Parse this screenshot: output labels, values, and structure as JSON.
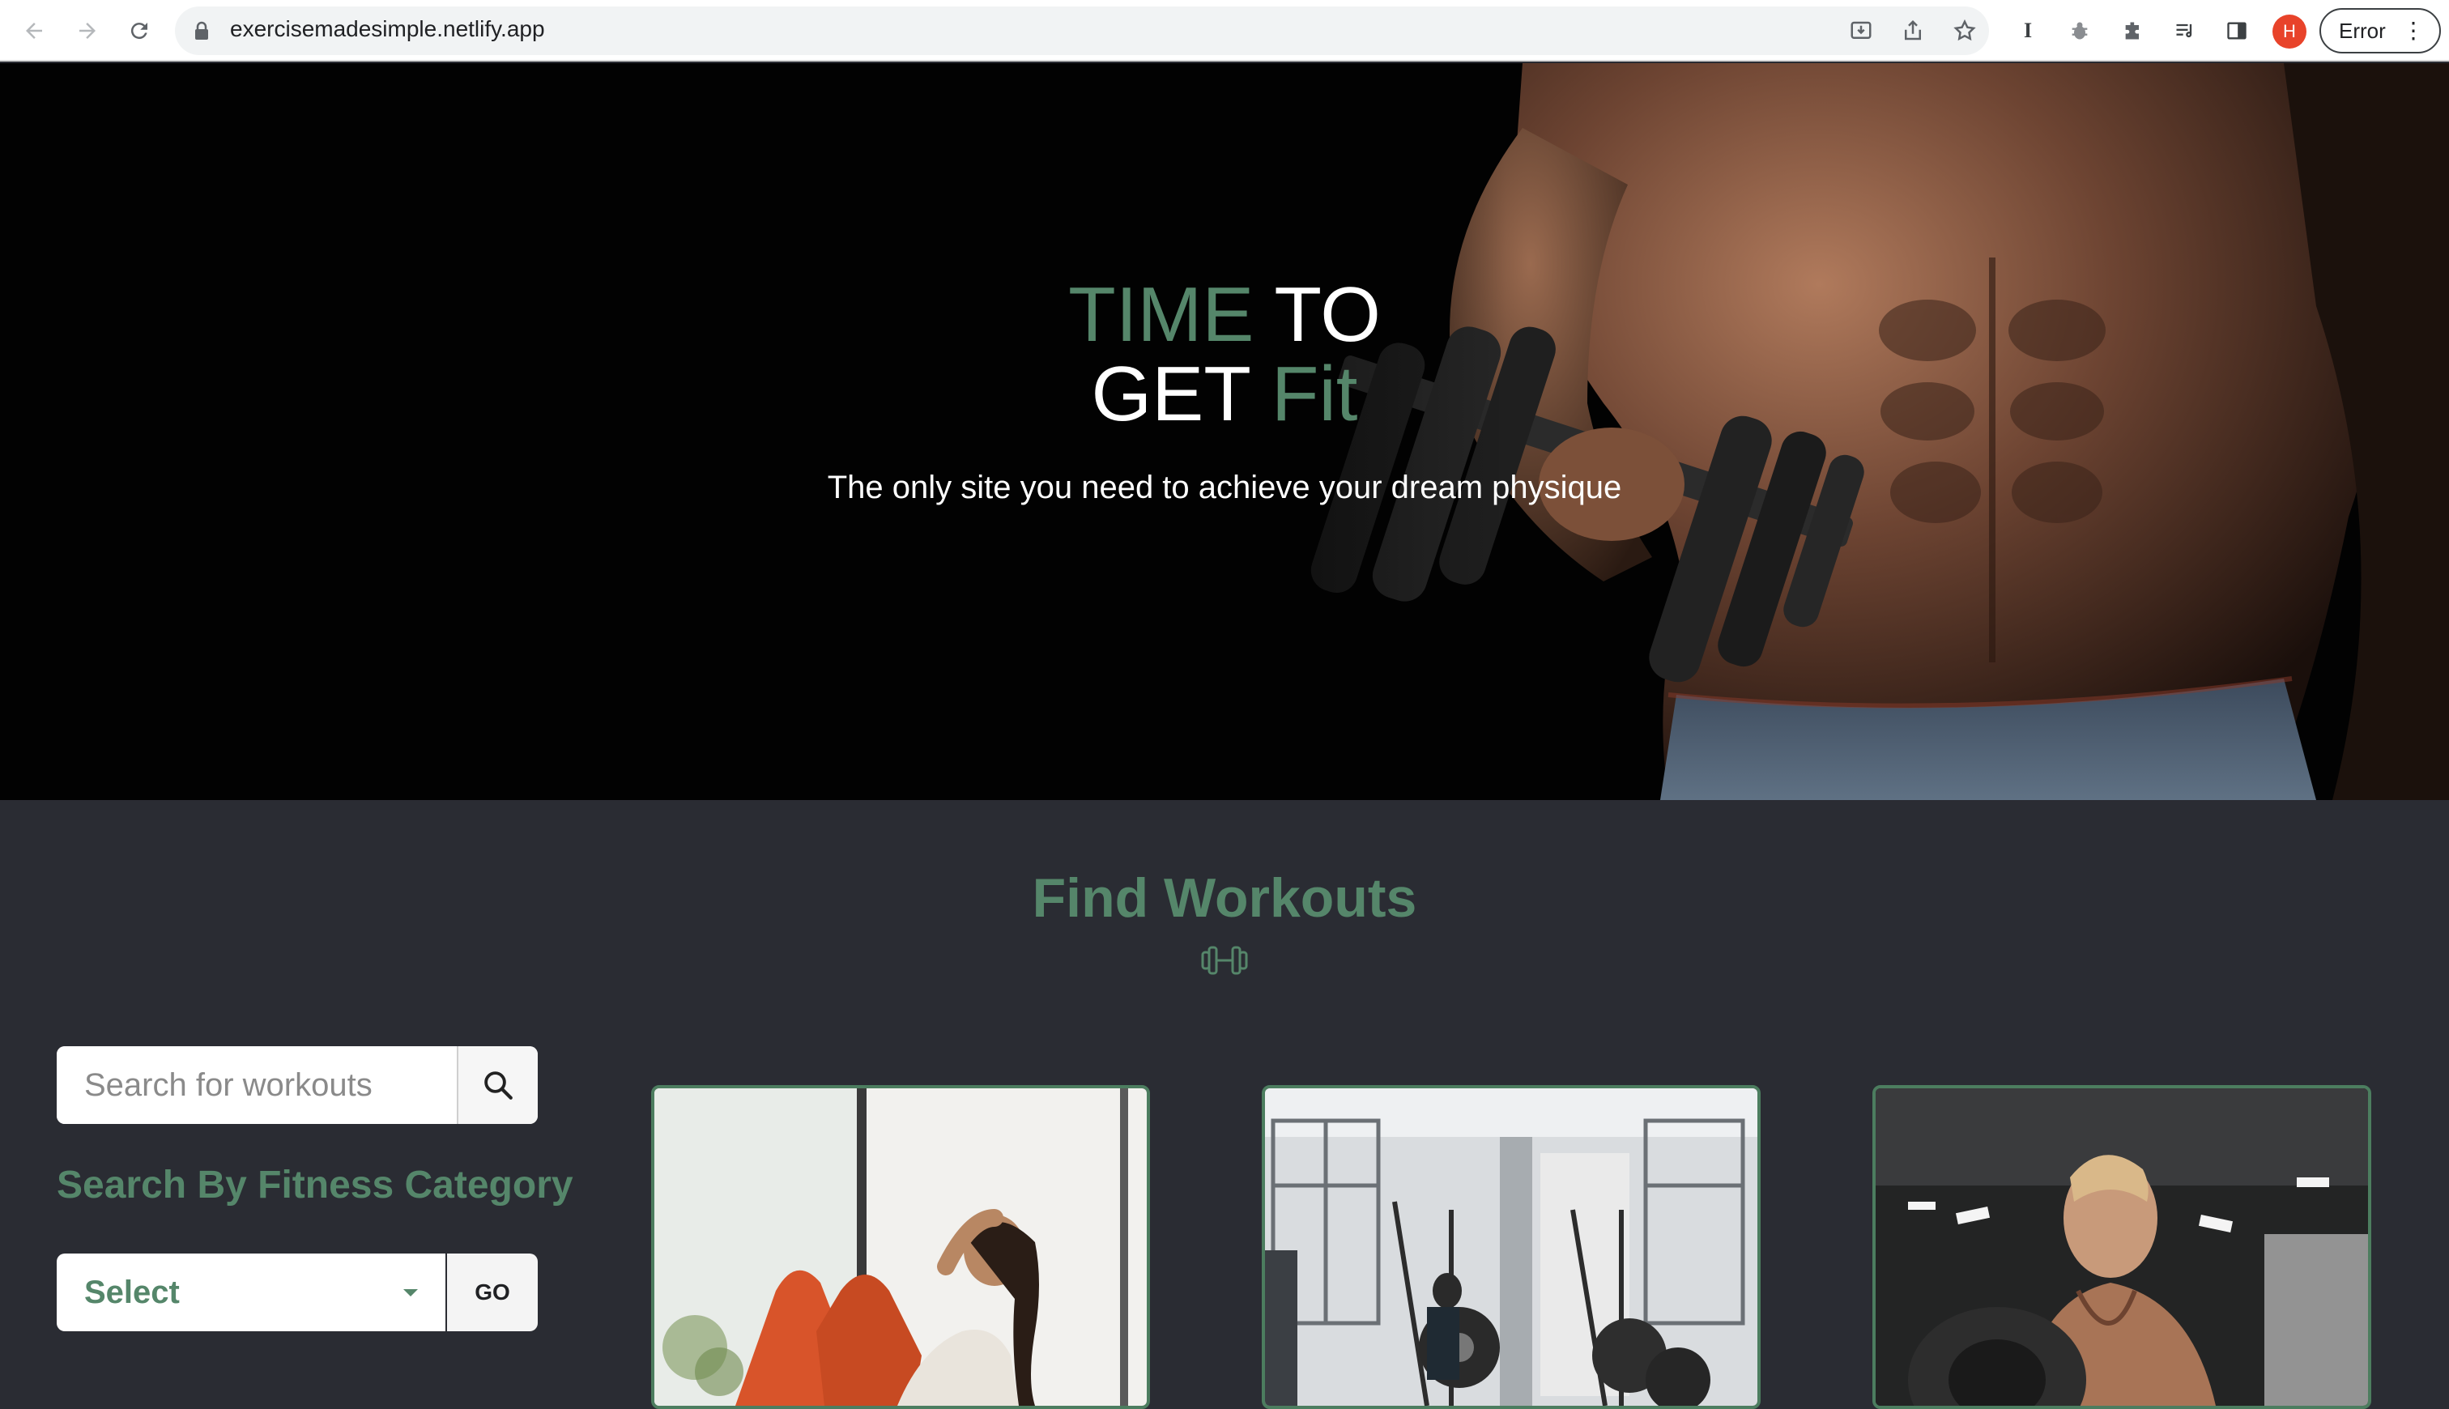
{
  "browser": {
    "url": "exercisemadesimple.netlify.app",
    "profile_initial": "H",
    "error_label": "Error",
    "icons": [
      "back-icon",
      "forward-icon",
      "reload-icon",
      "lock-icon",
      "install-icon",
      "share-icon",
      "bookmark-star-icon",
      "extension-i-icon",
      "bug-extension-icon",
      "puzzle-extensions-icon",
      "reading-list-icon",
      "side-panel-icon",
      "kebab-menu-icon"
    ]
  },
  "hero": {
    "title_line1_a": "TIME",
    "title_line1_b": "TO",
    "title_line2_a": "GET",
    "title_line2_b": "Fit",
    "subtitle": "The only site you need to achieve your dream physique"
  },
  "workouts": {
    "title": "Find Workouts",
    "search_placeholder": "Search for workouts",
    "category_title": "Search By Fitness Category",
    "select_value": "Select",
    "go_label": "GO"
  },
  "colors": {
    "accent": "#55866a",
    "section_bg": "#2a2c33",
    "hero_bg": "#020202"
  }
}
